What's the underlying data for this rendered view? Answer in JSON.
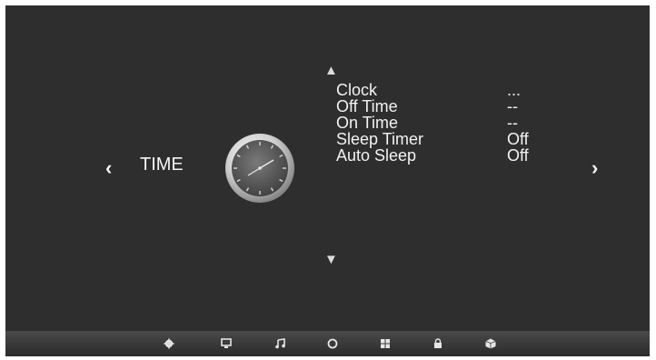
{
  "menu_title": "TIME",
  "nav": {
    "prev": "‹",
    "next": "›",
    "up": "▲",
    "down": "▼"
  },
  "items": [
    {
      "label": "Clock",
      "value": "..."
    },
    {
      "label": "Off Time",
      "value": "--"
    },
    {
      "label": "On Time",
      "value": "--"
    },
    {
      "label": "Sleep Timer",
      "value": "Off"
    },
    {
      "label": "Auto Sleep",
      "value": "Off"
    }
  ],
  "bottom_icons": [
    "settings-icon",
    "picture-icon",
    "sound-icon",
    "time-icon",
    "channel-icon",
    "lock-icon",
    "setup-icon"
  ],
  "colors": {
    "background": "#2e2e2e",
    "text": "#f2f2f2"
  }
}
